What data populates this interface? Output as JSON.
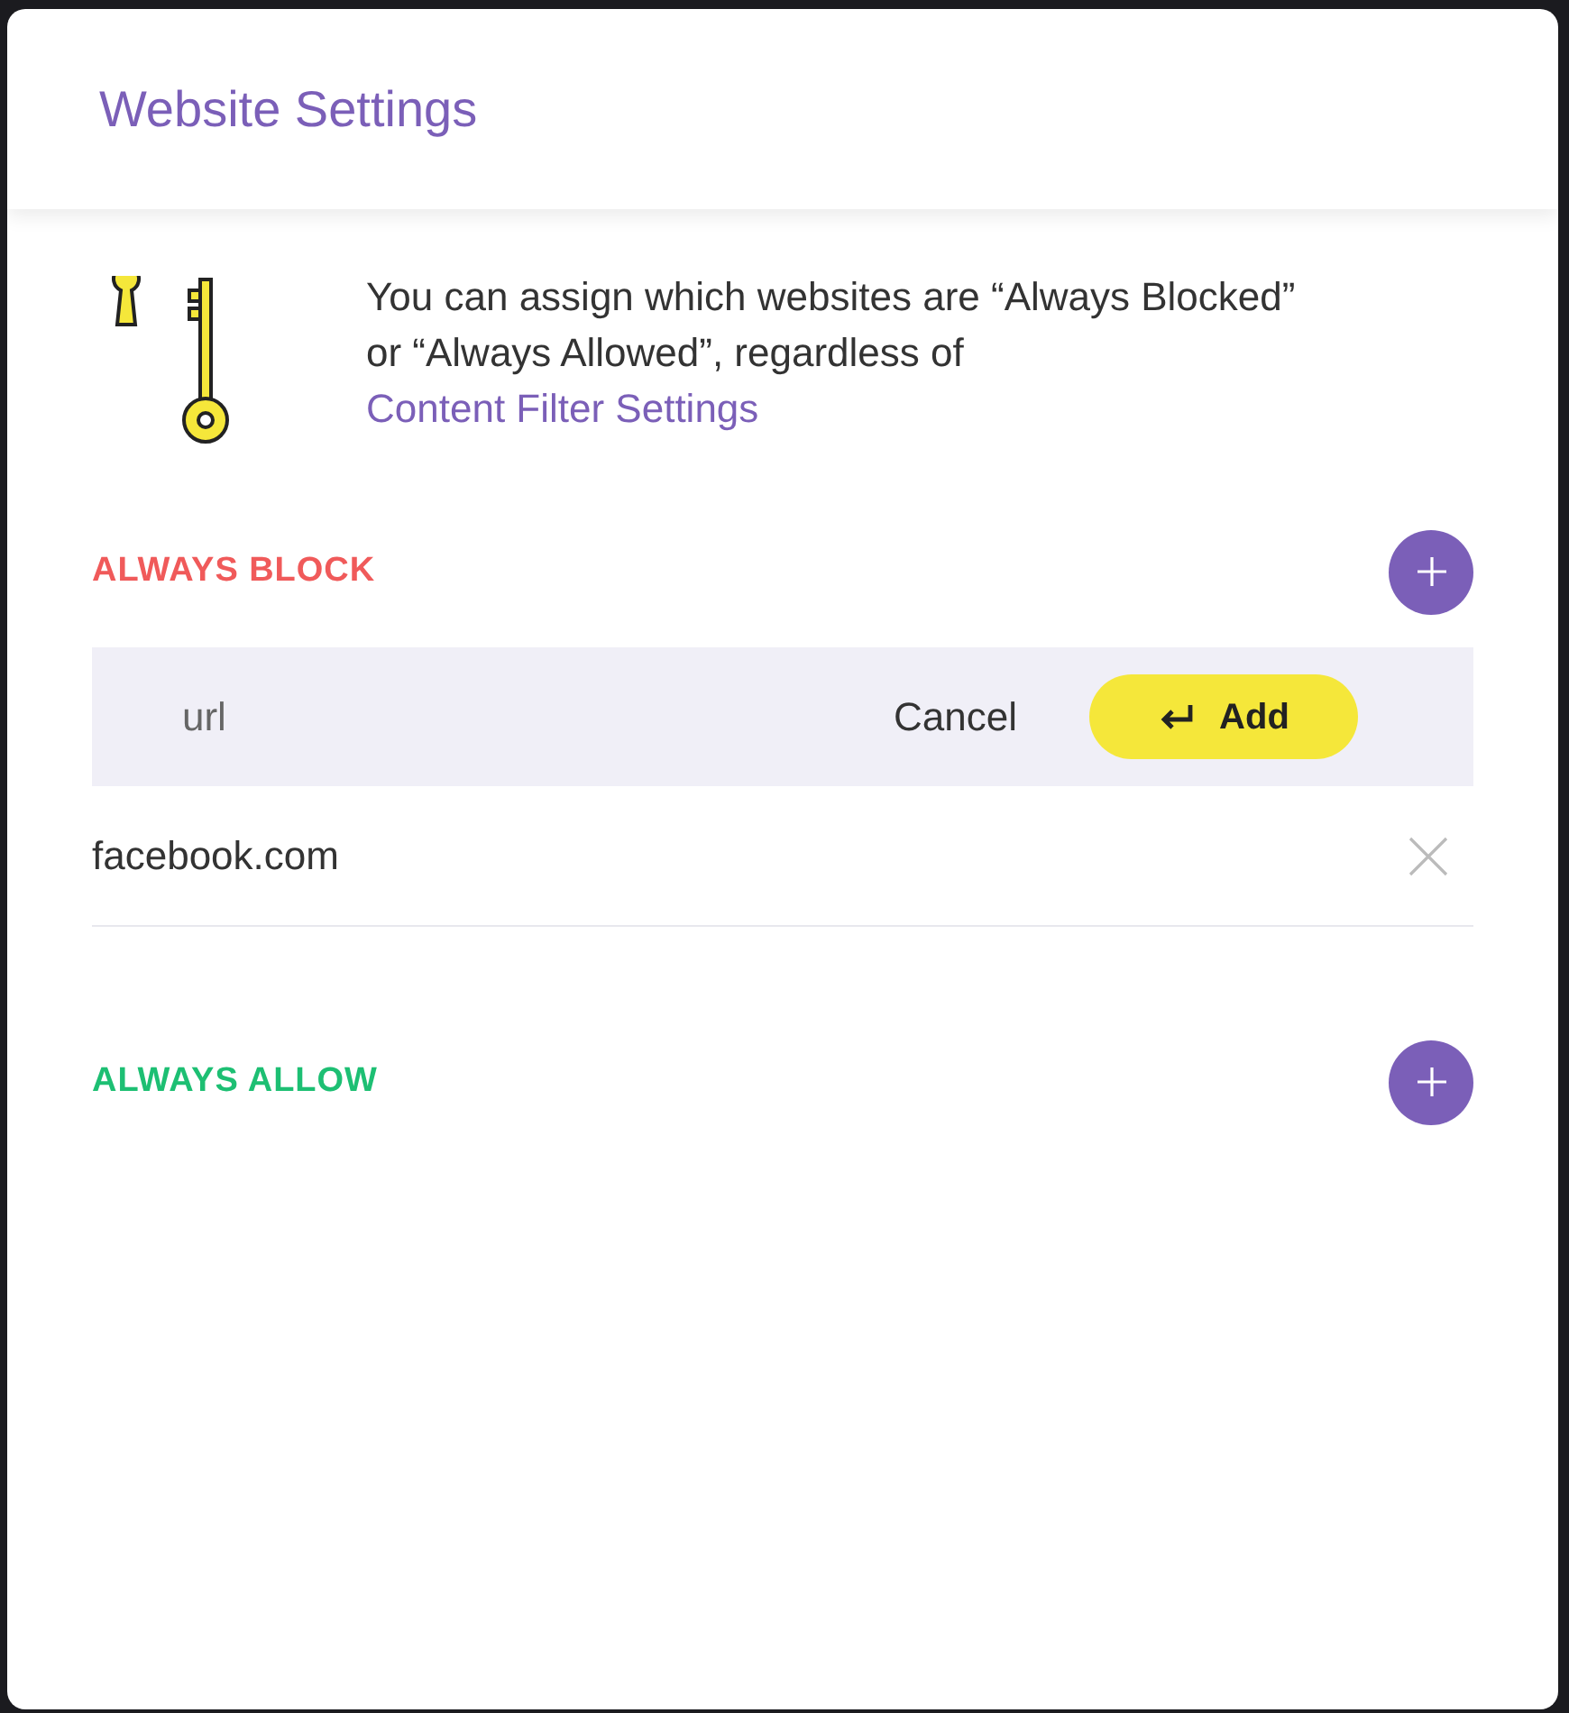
{
  "dialog": {
    "title": "Website Settings"
  },
  "intro": {
    "text": "You can assign which websites are “Always Blocked” or “Always Allowed”, regardless of",
    "link": "Content Filter Settings"
  },
  "sections": [
    {
      "title": "ALWAYS BLOCK",
      "color": "#f05a5a",
      "add_form": {
        "placeholder": "url",
        "cancel": "Cancel",
        "submit": "Add"
      },
      "entries": [
        "facebook.com"
      ]
    },
    {
      "title": "ALWAYS ALLOW",
      "color": "#1dbf73"
    }
  ]
}
